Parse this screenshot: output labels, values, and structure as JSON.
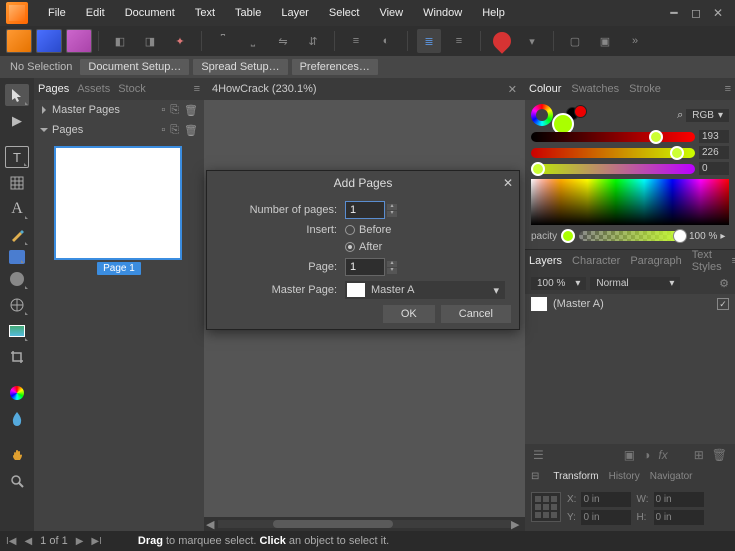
{
  "menu": {
    "items": [
      "File",
      "Edit",
      "Document",
      "Text",
      "Table",
      "Layer",
      "Select",
      "View",
      "Window",
      "Help"
    ]
  },
  "contextbar": {
    "noselection": "No Selection",
    "buttons": [
      "Document Setup…",
      "Spread Setup…",
      "Preferences…"
    ]
  },
  "pages": {
    "tabs": {
      "pages": "Pages",
      "assets": "Assets",
      "stock": "Stock"
    },
    "master_header": "Master Pages",
    "pages_header": "Pages",
    "page1_label": "Page 1"
  },
  "document": {
    "tab": "4HowCrack (230.1%)"
  },
  "dialog": {
    "title": "Add Pages",
    "number_label": "Number of pages:",
    "number_value": "1",
    "insert_label": "Insert:",
    "before": "Before",
    "after": "After",
    "page_label": "Page:",
    "page_value": "1",
    "master_label": "Master Page:",
    "master_value": "Master A",
    "ok": "OK",
    "cancel": "Cancel"
  },
  "colour": {
    "tabs": {
      "colour": "Colour",
      "swatches": "Swatches",
      "stroke": "Stroke"
    },
    "mode": "RGB",
    "sliders": [
      193,
      226,
      0
    ],
    "opacity_label": "pacity",
    "opacity": "100 %"
  },
  "layers": {
    "tabs": {
      "layers": "Layers",
      "character": "Character",
      "paragraph": "Paragraph",
      "textstyles": "Text Styles"
    },
    "opacity": "100 %",
    "blend": "Normal",
    "row_name": "(Master A)"
  },
  "transform": {
    "tabs": {
      "transform": "Transform",
      "history": "History",
      "navigator": "Navigator"
    },
    "x": "0 in",
    "y": "0 in",
    "w": "0 in",
    "h": "0 in"
  },
  "status": {
    "page_of": "1 of 1",
    "hint_drag": "Drag",
    "hint_drag_rest": " to marquee select. ",
    "hint_click": "Click",
    "hint_click_rest": " an object to select it."
  }
}
